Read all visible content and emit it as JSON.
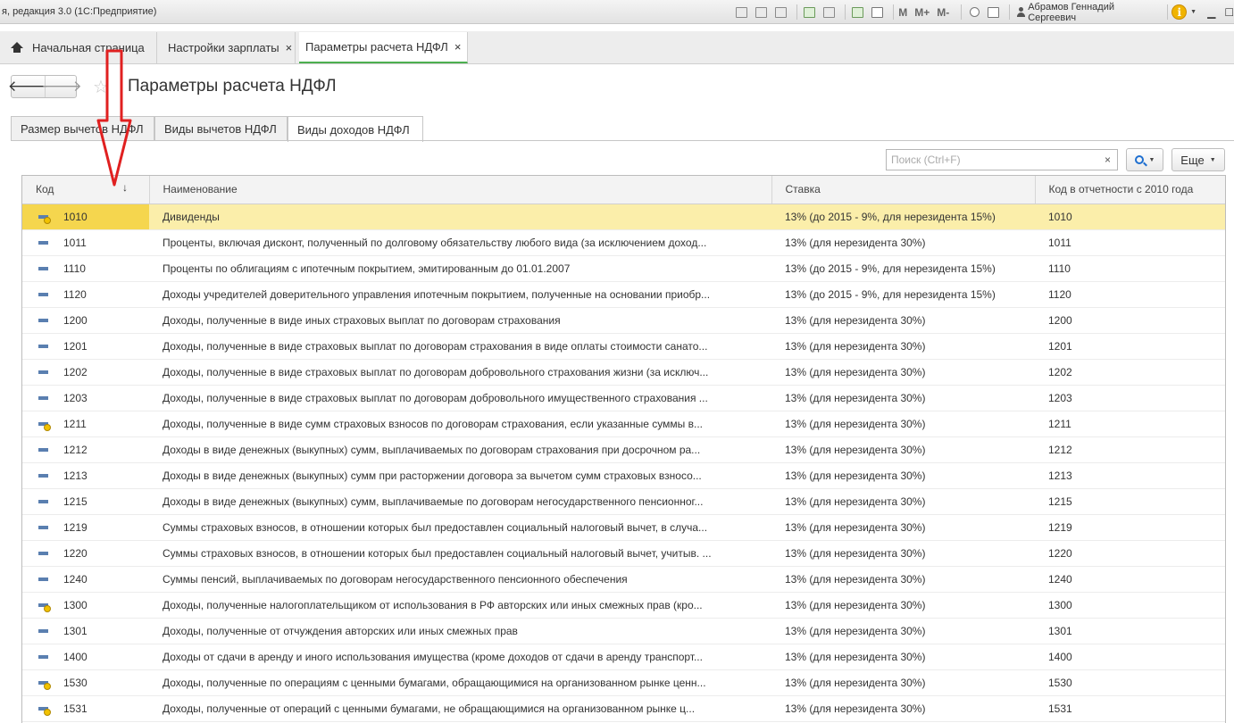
{
  "window": {
    "title": "я, редакция 3.0  (1С:Предприятие)",
    "user": "Абрамов Геннадий Сергеевич",
    "toolbar_m": [
      "M",
      "M+",
      "M-"
    ]
  },
  "tabs": [
    {
      "label": "Начальная страница",
      "closable": false
    },
    {
      "label": "Настройки зарплаты",
      "closable": true
    },
    {
      "label": "Параметры расчета НДФЛ",
      "closable": true
    }
  ],
  "close_glyph": "×",
  "nav": {
    "back": "🡐",
    "forward": "🡒"
  },
  "page_title": "Параметры расчета НДФЛ",
  "inner_tabs": [
    {
      "label": "Размер вычетов НДФЛ"
    },
    {
      "label": "Виды вычетов НДФЛ"
    },
    {
      "label": "Виды доходов НДФЛ"
    }
  ],
  "search": {
    "placeholder": "Поиск (Ctrl+F)",
    "clear": "×"
  },
  "more_button": "Еще",
  "table": {
    "columns": [
      "Код",
      "Наименование",
      "Ставка",
      "Код в отчетности  с 2010 года"
    ],
    "sort_indicator": "↓",
    "rows": [
      {
        "code": "1010",
        "name": "Дивиденды",
        "rate": "13% (до 2015 - 9%, для нерезидента 15%)",
        "report": "1010",
        "icon": "y",
        "selected": true
      },
      {
        "code": "1011",
        "name": "Проценты, включая дисконт, полученный по долговому обязательству любого вида (за исключением доход...",
        "rate": "13% (для нерезидента 30%)",
        "report": "1011",
        "icon": "n"
      },
      {
        "code": "1110",
        "name": "Проценты по облигациям с ипотечным покрытием, эмитированным до 01.01.2007",
        "rate": "13% (до 2015 - 9%, для нерезидента 15%)",
        "report": "1110",
        "icon": "n"
      },
      {
        "code": "1120",
        "name": "Доходы учредителей доверительного управления ипотечным покрытием, полученные на основании приобр...",
        "rate": "13% (до 2015 - 9%, для нерезидента 15%)",
        "report": "1120",
        "icon": "n"
      },
      {
        "code": "1200",
        "name": "Доходы, полученные в виде иных страховых выплат по договорам страхования",
        "rate": "13% (для нерезидента 30%)",
        "report": "1200",
        "icon": "n"
      },
      {
        "code": "1201",
        "name": "Доходы, полученные в виде страховых выплат по договорам страхования в виде оплаты стоимости санато...",
        "rate": "13% (для нерезидента 30%)",
        "report": "1201",
        "icon": "n"
      },
      {
        "code": "1202",
        "name": "Доходы, полученные в виде страховых выплат по договорам добровольного страхования жизни (за исключ...",
        "rate": "13% (для нерезидента 30%)",
        "report": "1202",
        "icon": "n"
      },
      {
        "code": "1203",
        "name": "Доходы, полученные в виде страховых выплат по договорам добровольного имущественного страхования ...",
        "rate": "13% (для нерезидента 30%)",
        "report": "1203",
        "icon": "n"
      },
      {
        "code": "1211",
        "name": "Доходы, полученные в виде сумм страховых взносов по договорам страхования, если указанные суммы в...",
        "rate": "13% (для нерезидента 30%)",
        "report": "1211",
        "icon": "y"
      },
      {
        "code": "1212",
        "name": "Доходы в виде денежных (выкупных) сумм, выплачиваемых по договорам страхования при досрочном ра...",
        "rate": "13% (для нерезидента 30%)",
        "report": "1212",
        "icon": "n"
      },
      {
        "code": "1213",
        "name": "Доходы в виде денежных (выкупных) сумм при расторжении договора за вычетом сумм страховых взносо...",
        "rate": "13% (для нерезидента 30%)",
        "report": "1213",
        "icon": "n"
      },
      {
        "code": "1215",
        "name": "Доходы в виде денежных (выкупных) сумм, выплачиваемые по договорам негосударственного пенсионног...",
        "rate": "13% (для нерезидента 30%)",
        "report": "1215",
        "icon": "n"
      },
      {
        "code": "1219",
        "name": "Суммы страховых взносов, в отношении которых был предоставлен социальный налоговый вычет, в случа...",
        "rate": "13% (для нерезидента 30%)",
        "report": "1219",
        "icon": "n"
      },
      {
        "code": "1220",
        "name": "Суммы страховых взносов, в отношении которых был предоставлен социальный налоговый вычет, учитыв. ...",
        "rate": "13% (для нерезидента 30%)",
        "report": "1220",
        "icon": "n"
      },
      {
        "code": "1240",
        "name": "Суммы пенсий, выплачиваемых по договорам негосударственного пенсионного обеспечения",
        "rate": "13% (для нерезидента 30%)",
        "report": "1240",
        "icon": "n"
      },
      {
        "code": "1300",
        "name": "Доходы, полученные налогоплательщиком от использования в РФ авторских или иных смежных прав (кро...",
        "rate": "13% (для нерезидента 30%)",
        "report": "1300",
        "icon": "y"
      },
      {
        "code": "1301",
        "name": "Доходы, полученные от отчуждения авторских или иных смежных прав",
        "rate": "13% (для нерезидента 30%)",
        "report": "1301",
        "icon": "n"
      },
      {
        "code": "1400",
        "name": "Доходы от сдачи в аренду и иного использования имущества (кроме доходов от сдачи в аренду транспорт...",
        "rate": "13% (для нерезидента 30%)",
        "report": "1400",
        "icon": "n"
      },
      {
        "code": "1530",
        "name": "Доходы, полученные по операциям с ценными бумагами, обращающимися на организованном рынке ценн...",
        "rate": "13% (для нерезидента 30%)",
        "report": "1530",
        "icon": "y"
      },
      {
        "code": "1531",
        "name": "Доходы, полученные от операций с ценными бумагами, не обращающимися  на  организованном  рынке  ц...",
        "rate": "13% (для нерезидента 30%)",
        "report": "1531",
        "icon": "y"
      }
    ]
  },
  "colors": {
    "selected_row": "#fbeeaa",
    "selected_code": "#f5d64e",
    "active_tab_underline": "#4caf50",
    "annotation": "#e02020"
  }
}
